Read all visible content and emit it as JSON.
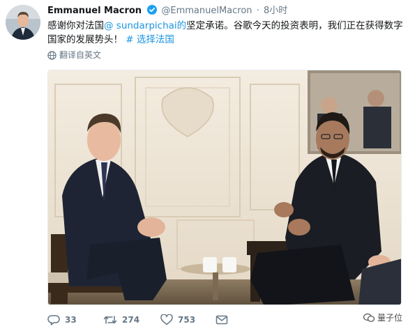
{
  "tweet": {
    "display_name": "Emmanuel Macron",
    "handle": "@EmmanuelMacron",
    "separator": "·",
    "time": "8小时",
    "text_part1": "感谢你对法国",
    "mention": "@ sundarpichai的",
    "text_part2": "坚定承诺。谷歌今天的投资表明，我们正在获得数字国家的发展势头！",
    "hashtag": "# 选择法国",
    "translate_label": "翻译自英文"
  },
  "actions": {
    "replies": "33",
    "retweets": "274",
    "likes": "753"
  },
  "watermark": {
    "label": "量子位"
  },
  "icons": {
    "verified": "verified-badge-icon",
    "translate": "globe-icon",
    "reply": "reply-icon",
    "retweet": "retweet-icon",
    "like": "heart-icon",
    "dm": "envelope-icon"
  },
  "colors": {
    "link": "#1b95e0",
    "muted": "#657786",
    "text": "#14171a"
  }
}
